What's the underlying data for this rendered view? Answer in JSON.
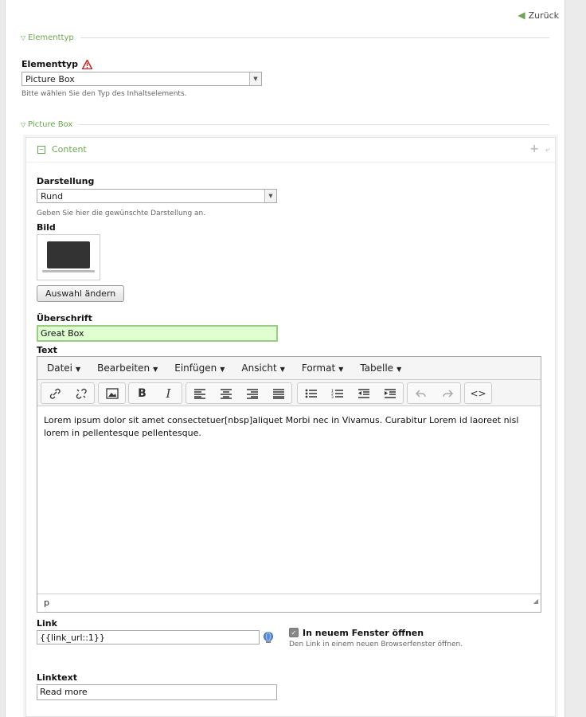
{
  "nav": {
    "back_label": "Zurück"
  },
  "section_elementtyp": {
    "legend": "Elementtyp",
    "field_label": "Elementtyp",
    "selected": "Picture Box",
    "hint": "Bitte wählen Sie den Typ des Inhaltselements."
  },
  "section_picturebox": {
    "legend": "Picture Box"
  },
  "content_box": {
    "title": "Content",
    "darstellung": {
      "label": "Darstellung",
      "selected": "Rund",
      "hint": "Geben Sie hier die gewünschte Darstellung an."
    },
    "bild": {
      "label": "Bild",
      "change_button": "Auswahl ändern"
    },
    "ueberschrift": {
      "label": "Überschrift",
      "value": "Great Box"
    },
    "text": {
      "label": "Text",
      "menu": [
        "Datei",
        "Bearbeiten",
        "Einfügen",
        "Ansicht",
        "Format",
        "Tabelle"
      ],
      "body": "Lorem ipsum dolor sit amet consectetuer[nbsp]aliquet Morbi nec in Vivamus. Curabitur Lorem id laoreet nisl lorem in pellentesque pellentesque.",
      "status_path": "p"
    },
    "link": {
      "label": "Link",
      "value": "{{link_url::1}}",
      "checkbox_label": "In neuem Fenster öffnen",
      "checkbox_checked": true,
      "checkbox_hint": "Den Link in einem neuen Browserfenster öffnen."
    },
    "linktext": {
      "label": "Linktext",
      "value": "Read more"
    }
  },
  "colors": {
    "accent": "#6aa84f",
    "warning": "#cc2222",
    "highlight_input": "#dfffd0"
  }
}
